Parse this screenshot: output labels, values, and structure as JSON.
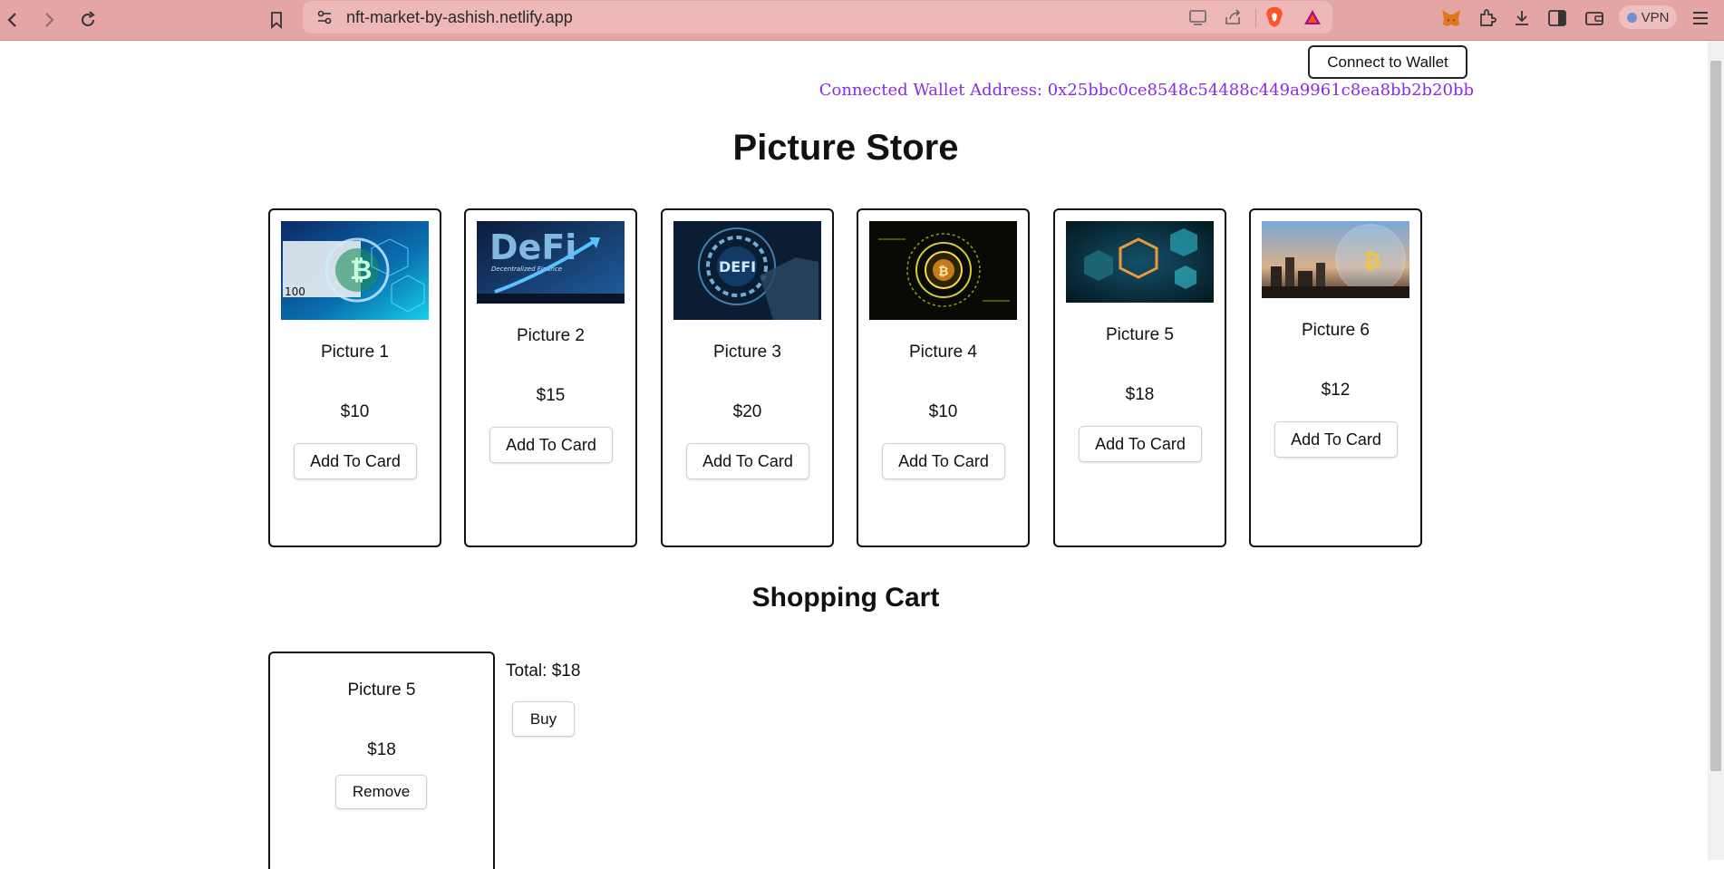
{
  "browser": {
    "url": "nft-market-by-ashish.netlify.app",
    "vpn_label": "VPN",
    "icons": [
      "back-icon",
      "forward-icon",
      "reload-icon",
      "bookmark-icon",
      "site-settings-icon",
      "cast-icon",
      "share-icon",
      "brave-shields-icon",
      "brave-rewards-icon",
      "metamask-icon",
      "extensions-icon",
      "download-icon",
      "sidebar-icon",
      "wallet-icon",
      "menu-icon"
    ]
  },
  "header": {
    "connect_button": "Connect to Wallet",
    "wallet_address": "Connected Wallet Address: 0x25bbc0ce8548c54488c449a9961c8ea8bb2b20bb",
    "address_color": "#8a2be2"
  },
  "store": {
    "title": "Picture Store",
    "items": [
      {
        "name": "Picture 1",
        "price": "$10",
        "button": "Add To Card"
      },
      {
        "name": "Picture 2",
        "price": "$15",
        "button": "Add To Card"
      },
      {
        "name": "Picture 3",
        "price": "$20",
        "button": "Add To Card"
      },
      {
        "name": "Picture 4",
        "price": "$10",
        "button": "Add To Card"
      },
      {
        "name": "Picture 5",
        "price": "$18",
        "button": "Add To Card"
      },
      {
        "name": "Picture 6",
        "price": "$12",
        "button": "Add To Card"
      }
    ]
  },
  "cart": {
    "title": "Shopping Cart",
    "items": [
      {
        "name": "Picture 5",
        "price": "$18",
        "button": "Remove"
      }
    ],
    "total": "Total: $18",
    "buy_button": "Buy"
  },
  "image_text": {
    "picture1_note": "100",
    "picture2_text": "DeFi",
    "picture2_sub": "Decentralized Finance",
    "picture3_text": "DEFI"
  }
}
